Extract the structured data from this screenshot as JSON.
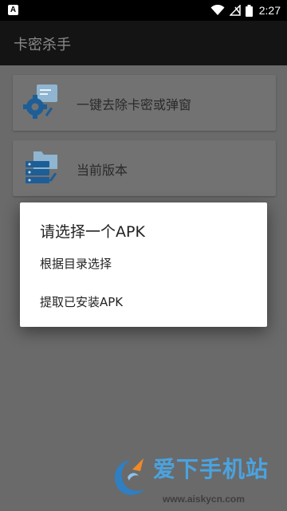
{
  "status_bar": {
    "notification_letter": "A",
    "time": "2:27",
    "icons": [
      "wifi-icon",
      "signal-off-icon",
      "battery-icon"
    ]
  },
  "app_bar": {
    "title": "卡密杀手"
  },
  "cards": [
    {
      "label": "一键去除卡密或弹窗",
      "icon": "gear-document-icon"
    },
    {
      "label": "当前版本",
      "icon": "folder-server-icon"
    }
  ],
  "dialog": {
    "title": "请选择一个APK",
    "options": [
      "根据目录选择",
      "提取已安装APK"
    ]
  },
  "watermark": {
    "text": "爱下手机站",
    "url": "www.aiskycn.com",
    "accent": "#4aa3e0"
  },
  "colors": {
    "app_bar": "#141414",
    "background_dimmed": "#6a6a6a",
    "dialog": "#ffffff"
  }
}
